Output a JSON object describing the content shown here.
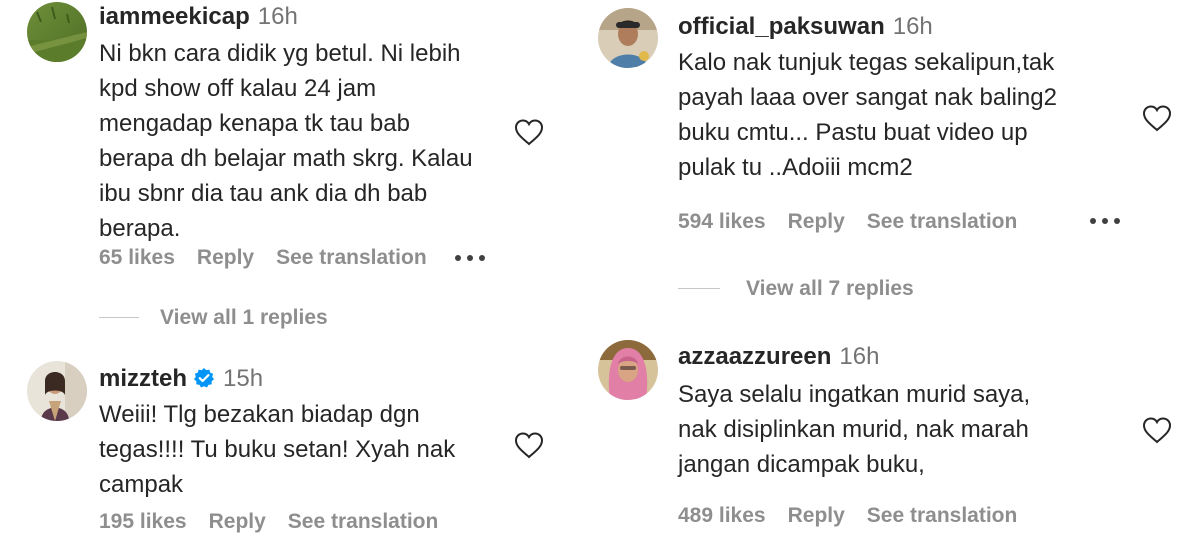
{
  "comments": [
    {
      "username": "iammeekicap",
      "time": "16h",
      "text": "Ni bkn cara didik yg betul. Ni lebih\nkpd show off kalau 24 jam\nmengadap kenapa tk tau bab\nberapa dh belajar math skrg. Kalau\nibu sbnr dia tau ank dia dh bab\nberapa.",
      "likes": "65 likes",
      "reply": "Reply",
      "translate": "See translation",
      "view_replies": "View all 1 replies",
      "avatar_icon": "grass-photo-avatar"
    },
    {
      "username": "mizzteh",
      "verified": true,
      "time": "15h",
      "text": "Weiii! Tlg bezakan biadap dgn\ntegas!!!! Tu buku setan! Xyah nak\ncampak",
      "likes": "195 likes",
      "reply": "Reply",
      "translate": "See translation",
      "avatar_icon": "woman-portrait-avatar"
    },
    {
      "username": "official_paksuwan",
      "time": "16h",
      "text": "Kalo nak tunjuk tegas sekalipun,tak\npayah laaa over sangat nak baling2\nbuku cmtu... Pastu buat video up\npulak tu ..Adoiii mcm2",
      "likes": "594 likes",
      "reply": "Reply",
      "translate": "See translation",
      "view_replies": "View all 7 replies",
      "avatar_icon": "man-portrait-avatar"
    },
    {
      "username": "azzaazzureen",
      "time": "16h",
      "text": "Saya selalu ingatkan murid saya,\nnak disiplinkan murid, nak marah\njangan dicampak buku,",
      "likes": "489 likes",
      "reply": "Reply",
      "translate": "See translation",
      "avatar_icon": "woman-hijab-avatar"
    }
  ],
  "colors": {
    "username": "#262626",
    "secondary": "#8e8e8e",
    "verified": "#0095f6"
  }
}
